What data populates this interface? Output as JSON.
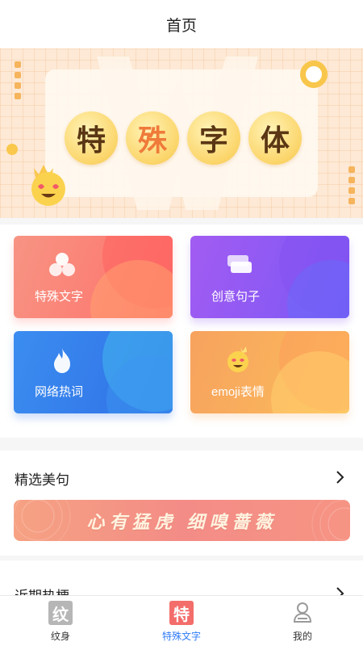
{
  "header": {
    "title": "首页"
  },
  "banner": {
    "title_chars": [
      "特",
      "殊",
      "字",
      "体"
    ]
  },
  "tiles": [
    {
      "label": "特殊文字"
    },
    {
      "label": "创意句子"
    },
    {
      "label": "网络热词"
    },
    {
      "label": "emoji表情"
    }
  ],
  "featured": {
    "title": "精选美句",
    "banner_text": "心有猛虎 细嗅蔷薇"
  },
  "recent": {
    "title": "近期热梗"
  },
  "tabbar": {
    "tabs": [
      {
        "icon_char": "纹",
        "label": "纹身",
        "active": false
      },
      {
        "icon_char": "特",
        "label": "特殊文字",
        "active": true
      },
      {
        "icon_char": "",
        "label": "我的",
        "active": false
      }
    ]
  },
  "colors": {
    "active_tab": "#2f7cf6",
    "accent_orange": "#ef7a3a"
  }
}
